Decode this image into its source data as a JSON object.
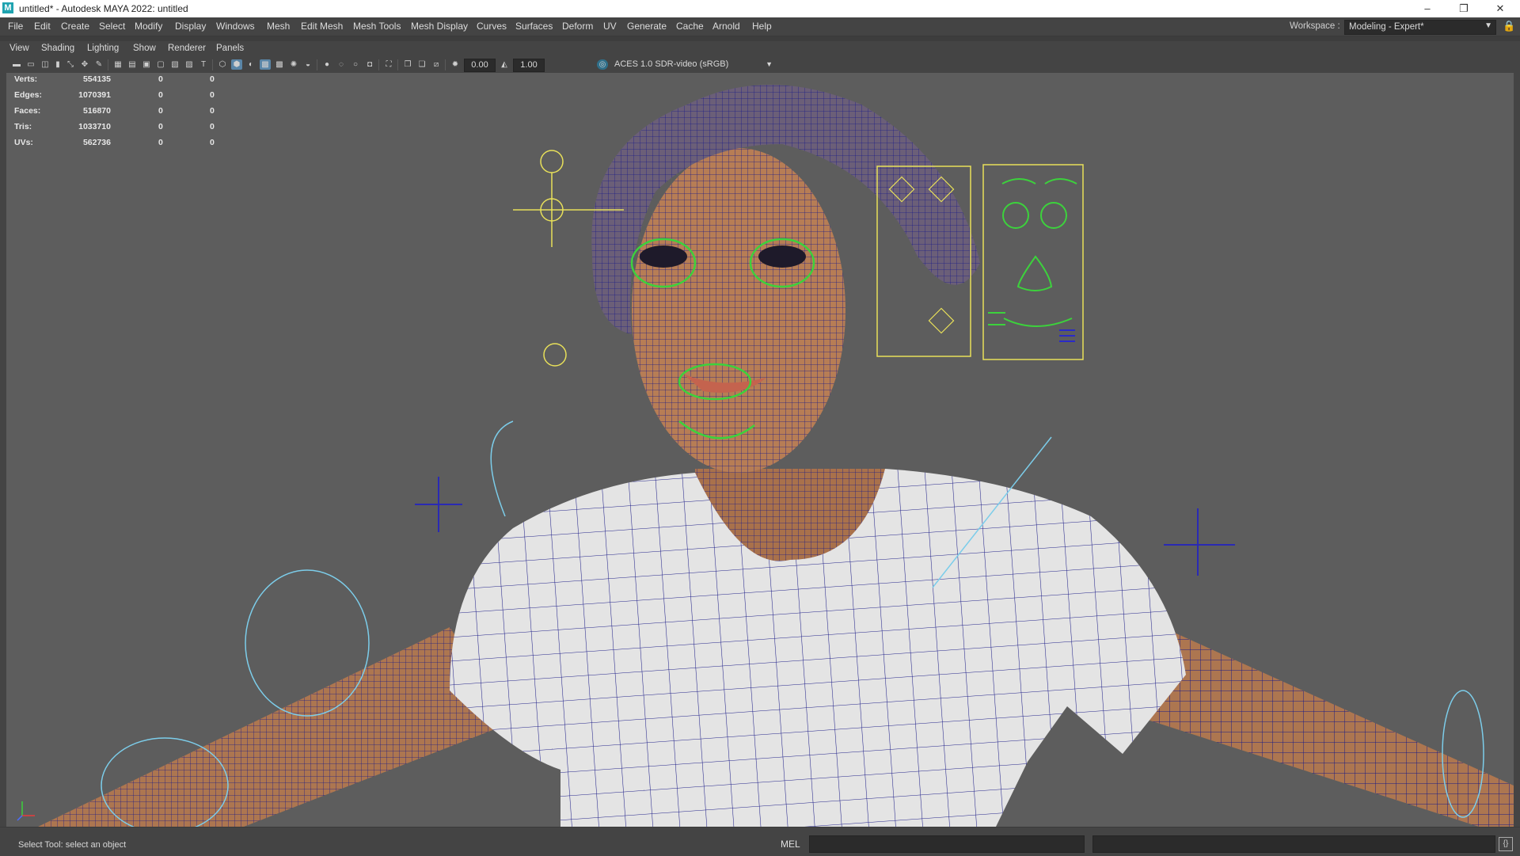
{
  "window": {
    "title": "untitled* - Autodesk MAYA 2022: untitled",
    "app_icon": "M",
    "minimize": "–",
    "maximize": "❐",
    "close": "✕"
  },
  "menubar": {
    "items": [
      "File",
      "Edit",
      "Create",
      "Select",
      "Modify",
      "Display",
      "Windows",
      "Mesh",
      "Edit Mesh",
      "Mesh Tools",
      "Mesh Display",
      "Curves",
      "Surfaces",
      "Deform",
      "UV",
      "Generate",
      "Cache",
      "Arnold",
      "Help"
    ],
    "workspace_label": "Workspace :",
    "workspace_value": "Modeling - Expert*"
  },
  "panel_menu": {
    "items": [
      "View",
      "Shading",
      "Lighting",
      "Show",
      "Renderer",
      "Panels"
    ]
  },
  "toolbar": {
    "exposure": "0.00",
    "gamma": "1.00",
    "color_transform": "ACES 1.0 SDR-video (sRGB)"
  },
  "hud": {
    "rows": [
      {
        "label": "Verts:",
        "value": "554135",
        "sel": "0",
        "extra": "0"
      },
      {
        "label": "Edges:",
        "value": "1070391",
        "sel": "0",
        "extra": "0"
      },
      {
        "label": "Faces:",
        "value": "516870",
        "sel": "0",
        "extra": "0"
      },
      {
        "label": "Tris:",
        "value": "1033710",
        "sel": "0",
        "extra": "0"
      },
      {
        "label": "UVs:",
        "value": "562736",
        "sel": "0",
        "extra": "0"
      }
    ]
  },
  "status": {
    "help_line": "Select Tool: select an object",
    "command_language": "MEL"
  },
  "colors": {
    "viewport_bg": "#5d5d5d",
    "skin": "#b07a52",
    "shirt": "#e6e6e6",
    "wireframe": "#1a1a8c",
    "controls_yellow": "#e8e05a",
    "controls_green": "#3cd23c",
    "controls_cyan": "#7ccdea"
  },
  "icons": {
    "lock": "lock-icon",
    "script_editor": "script-editor-icon",
    "axis": "axis-indicator-icon"
  }
}
